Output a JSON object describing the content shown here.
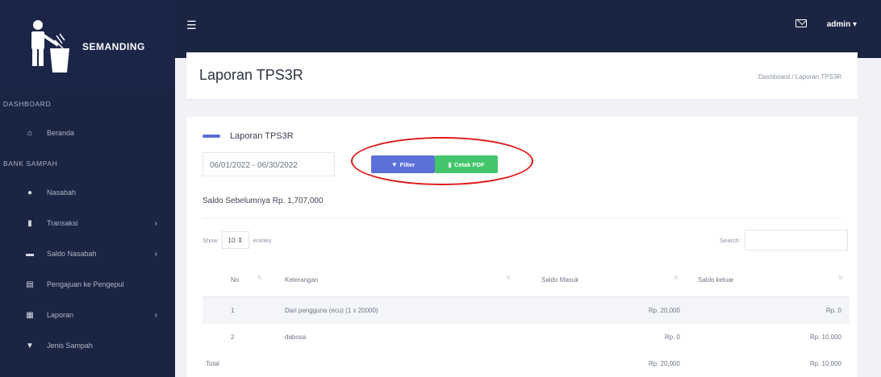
{
  "brand": {
    "name": "SEMANDING"
  },
  "sidebar": {
    "sections": [
      {
        "label": "DASHBOARD",
        "items": [
          {
            "label": "Beranda",
            "icon": "home-icon",
            "has_caret": false
          }
        ]
      },
      {
        "label": "BANK SAMPAH",
        "items": [
          {
            "label": "Nasabah",
            "icon": "users-icon",
            "has_caret": false
          },
          {
            "label": "Transaksi",
            "icon": "book-icon",
            "has_caret": true
          },
          {
            "label": "Saldo Nasabah",
            "icon": "wallet-icon",
            "has_caret": true
          },
          {
            "label": "Pengajuan ke Pengepul",
            "icon": "chart-icon",
            "has_caret": false
          },
          {
            "label": "Laporan",
            "icon": "file-icon",
            "has_caret": true
          },
          {
            "label": "Jenis Sampah",
            "icon": "trash-icon",
            "has_caret": false
          }
        ]
      }
    ]
  },
  "topbar": {
    "user": "admin"
  },
  "header": {
    "title": "Laporan TPS3R",
    "breadcrumb": "Dashboard / Laporan TPS3R"
  },
  "card": {
    "title": "Laporan TPS3R",
    "date_range": "06/01/2022 - 06/30/2022",
    "filter_label": "Filter",
    "pdf_label": "Cetak PDF",
    "saldo_text": "Saldo Sebelumnya Rp. 1,707,000",
    "show_label": "Show",
    "show_value": "10",
    "entries_label": "entries",
    "search_label": "Search:"
  },
  "table": {
    "headers": [
      "No",
      "Keterangan",
      "Saldo Masuk",
      "Saldo keluar"
    ],
    "rows": [
      [
        "1",
        "Dari pengguna (ecu) (1 x 20000)",
        "Rp. 20,000",
        "Rp. 0"
      ],
      [
        "2",
        "dabosa",
        "Rp. 0",
        "Rp. 10,000"
      ]
    ],
    "footer": {
      "label": "Total",
      "masuk": "Rp. 20,000",
      "keluar": "Rp. 10,000"
    }
  },
  "colors": {
    "sidebar": "#1a2443",
    "filter_button": "#5b70d9",
    "pdf_button": "#43c66b",
    "annotation": "#e01818"
  }
}
